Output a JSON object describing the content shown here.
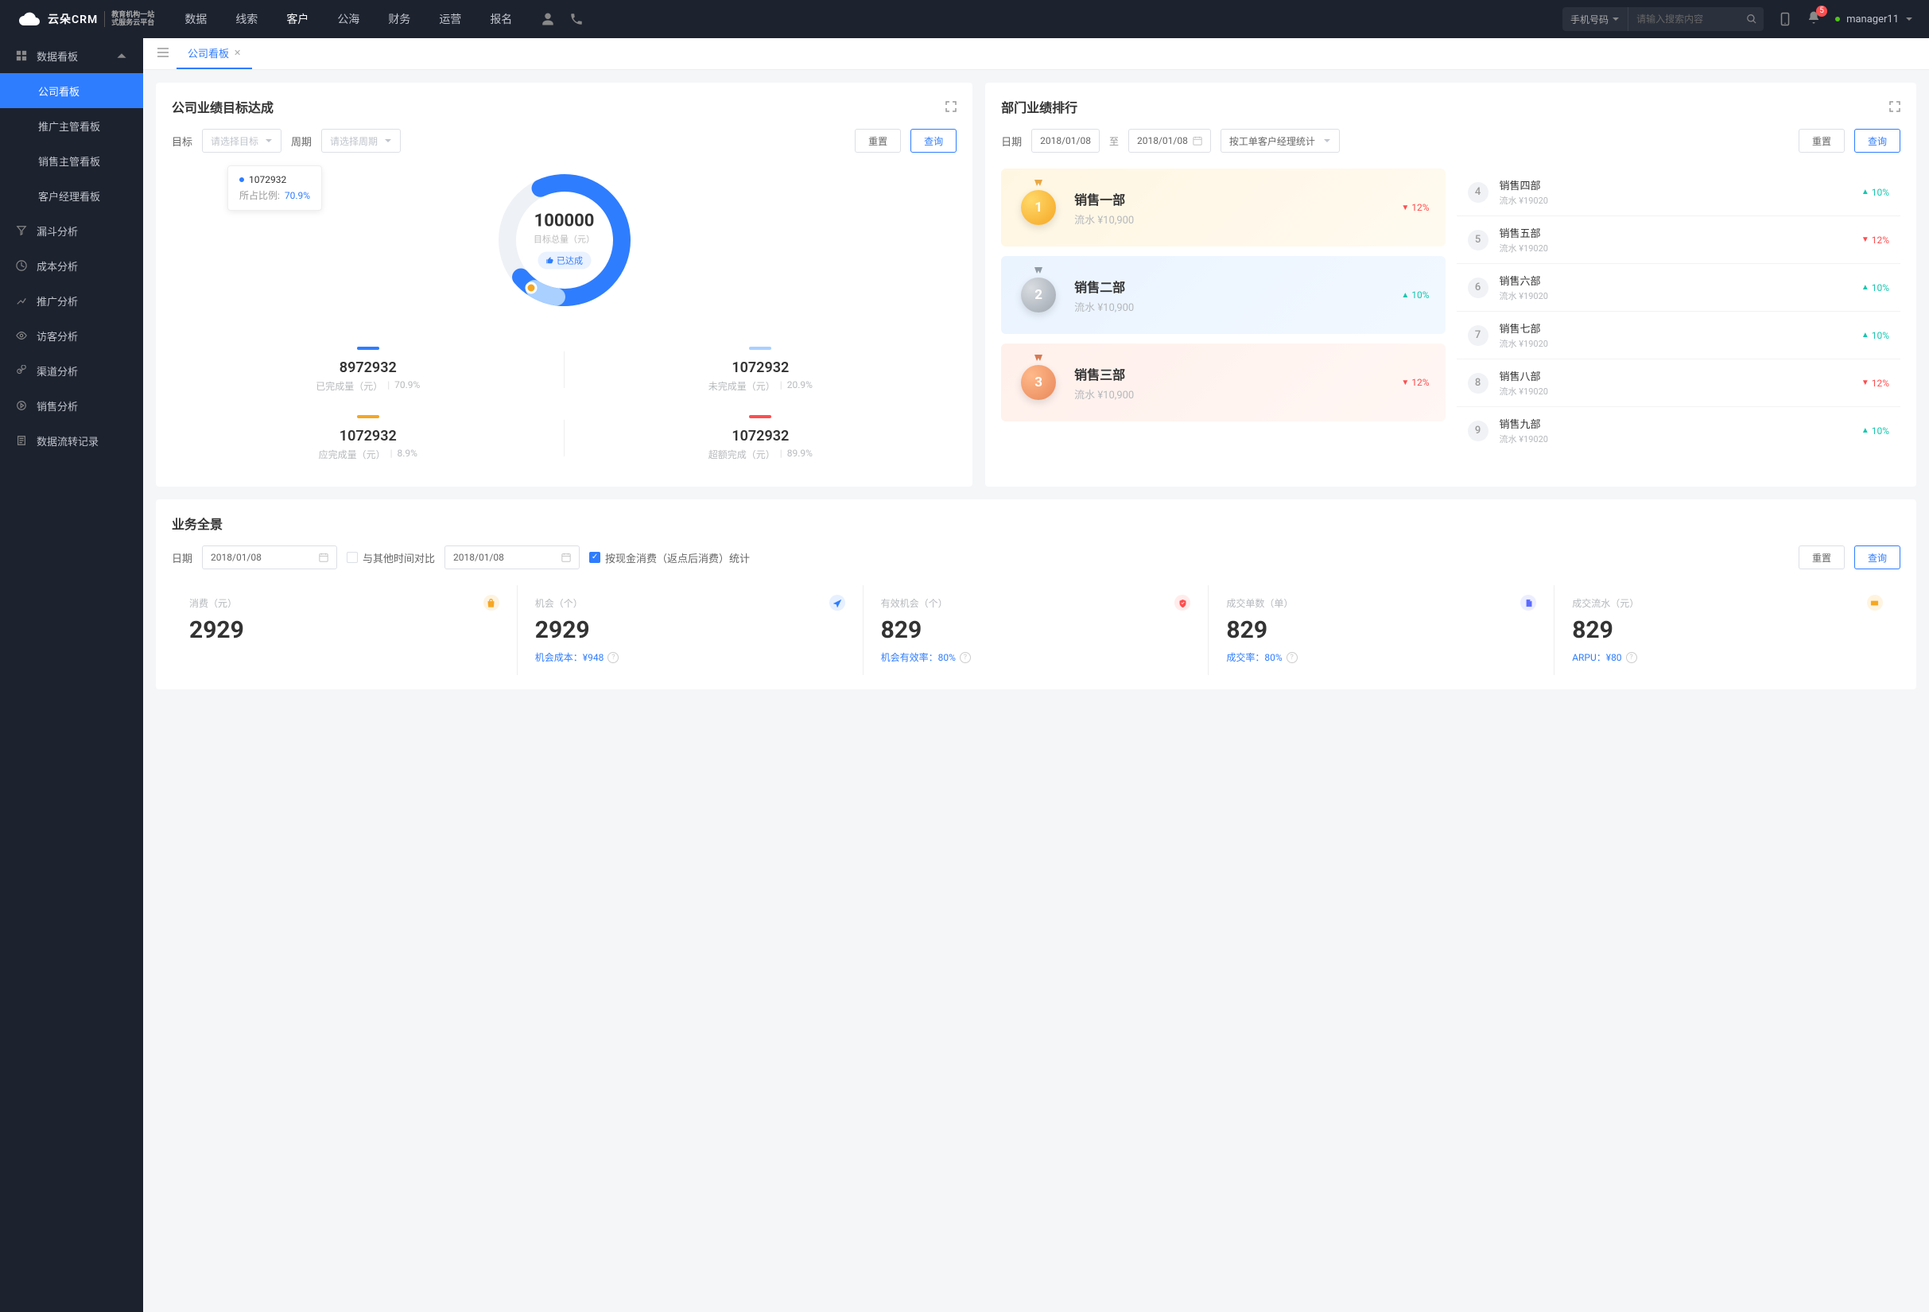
{
  "topnav": {
    "logo_main": "云朵CRM",
    "logo_sub1": "教育机构一站",
    "logo_sub2": "式服务云平台",
    "items": [
      "数据",
      "线索",
      "客户",
      "公海",
      "财务",
      "运营",
      "报名"
    ],
    "active_index": 2,
    "search_type": "手机号码",
    "search_placeholder": "请输入搜索内容",
    "notification_count": "5",
    "username": "manager11"
  },
  "sidebar": {
    "group": "数据看板",
    "group_items": [
      "公司看板",
      "推广主管看板",
      "销售主管看板",
      "客户经理看板"
    ],
    "active_sub_index": 0,
    "items": [
      "漏斗分析",
      "成本分析",
      "推广分析",
      "访客分析",
      "渠道分析",
      "销售分析",
      "数据流转记录"
    ]
  },
  "tabs": {
    "active": "公司看板"
  },
  "goal": {
    "title": "公司业绩目标达成",
    "target_label": "目标",
    "target_placeholder": "请选择目标",
    "period_label": "周期",
    "period_placeholder": "请选择周期",
    "reset": "重置",
    "query": "查询",
    "tooltip_value": "1072932",
    "tooltip_pct_label": "所占比例:",
    "tooltip_pct": "70.9%",
    "center_value": "100000",
    "center_label": "目标总量（元）",
    "achieved_label": "已达成",
    "stats": [
      {
        "bar_color": "#2f7dff",
        "value": "8972932",
        "label": "已完成量（元）",
        "pct": "70.9%"
      },
      {
        "bar_color": "#a9d0ff",
        "value": "1072932",
        "label": "未完成量（元）",
        "pct": "20.9%"
      },
      {
        "bar_color": "#f5a623",
        "value": "1072932",
        "label": "应完成量（元）",
        "pct": "8.9%"
      },
      {
        "bar_color": "#ff4d4f",
        "value": "1072932",
        "label": "超额完成（元）",
        "pct": "89.9%"
      }
    ]
  },
  "ranking": {
    "title": "部门业绩排行",
    "date_label": "日期",
    "date_from": "2018/01/08",
    "date_to": "2018/01/08",
    "date_sep": "至",
    "mode": "按工单客户经理统计",
    "reset": "重置",
    "query": "查询",
    "top3": [
      {
        "rank": "1",
        "name": "销售一部",
        "flow": "流水 ¥10,900",
        "pct": "12%",
        "dir": "down"
      },
      {
        "rank": "2",
        "name": "销售二部",
        "flow": "流水 ¥10,900",
        "pct": "10%",
        "dir": "up"
      },
      {
        "rank": "3",
        "name": "销售三部",
        "flow": "流水 ¥10,900",
        "pct": "12%",
        "dir": "down"
      }
    ],
    "rest": [
      {
        "rank": "4",
        "name": "销售四部",
        "flow": "流水 ¥19020",
        "pct": "10%",
        "dir": "up"
      },
      {
        "rank": "5",
        "name": "销售五部",
        "flow": "流水 ¥19020",
        "pct": "12%",
        "dir": "down"
      },
      {
        "rank": "6",
        "name": "销售六部",
        "flow": "流水 ¥19020",
        "pct": "10%",
        "dir": "up"
      },
      {
        "rank": "7",
        "name": "销售七部",
        "flow": "流水 ¥19020",
        "pct": "10%",
        "dir": "up"
      },
      {
        "rank": "8",
        "name": "销售八部",
        "flow": "流水 ¥19020",
        "pct": "12%",
        "dir": "down"
      },
      {
        "rank": "9",
        "name": "销售九部",
        "flow": "流水 ¥19020",
        "pct": "10%",
        "dir": "up"
      }
    ]
  },
  "overview": {
    "title": "业务全景",
    "date_label": "日期",
    "date_value": "2018/01/08",
    "compare_label": "与其他时间对比",
    "compare_date": "2018/01/08",
    "cash_option": "按现金消费（返点后消费）统计",
    "reset": "重置",
    "query": "查询",
    "kpis": [
      {
        "label": "消费（元）",
        "value": "2929",
        "sub": "",
        "icon_bg": "#fdf3e0",
        "icon_fill": "#f5a623",
        "icon": "bag"
      },
      {
        "label": "机会（个）",
        "value": "2929",
        "sub": "机会成本：¥948",
        "icon_bg": "#e6f0ff",
        "icon_fill": "#2f7dff",
        "icon": "send"
      },
      {
        "label": "有效机会（个）",
        "value": "829",
        "sub": "机会有效率：80%",
        "icon_bg": "#ffeceb",
        "icon_fill": "#ff4d4f",
        "icon": "shield"
      },
      {
        "label": "成交单数（单）",
        "value": "829",
        "sub": "成交率：80%",
        "icon_bg": "#eceeff",
        "icon_fill": "#5c6bff",
        "icon": "doc"
      },
      {
        "label": "成交流水（元）",
        "value": "829",
        "sub": "ARPU：¥80",
        "icon_bg": "#fff4e0",
        "icon_fill": "#f5a623",
        "icon": "card"
      }
    ]
  },
  "chart_data": {
    "type": "pie",
    "title": "公司业绩目标达成",
    "total": 100000,
    "total_label": "目标总量（元）",
    "series": [
      {
        "name": "已完成量（元）",
        "value": 8972932,
        "pct": 70.9,
        "color": "#2f7dff"
      },
      {
        "name": "未完成量（元）",
        "value": 1072932,
        "pct": 20.9,
        "color": "#a9d0ff"
      },
      {
        "name": "应完成量（元）",
        "value": 1072932,
        "pct": 8.9,
        "color": "#f5a623"
      },
      {
        "name": "超额完成（元）",
        "value": 1072932,
        "pct": 89.9,
        "color": "#ff4d4f"
      }
    ]
  }
}
